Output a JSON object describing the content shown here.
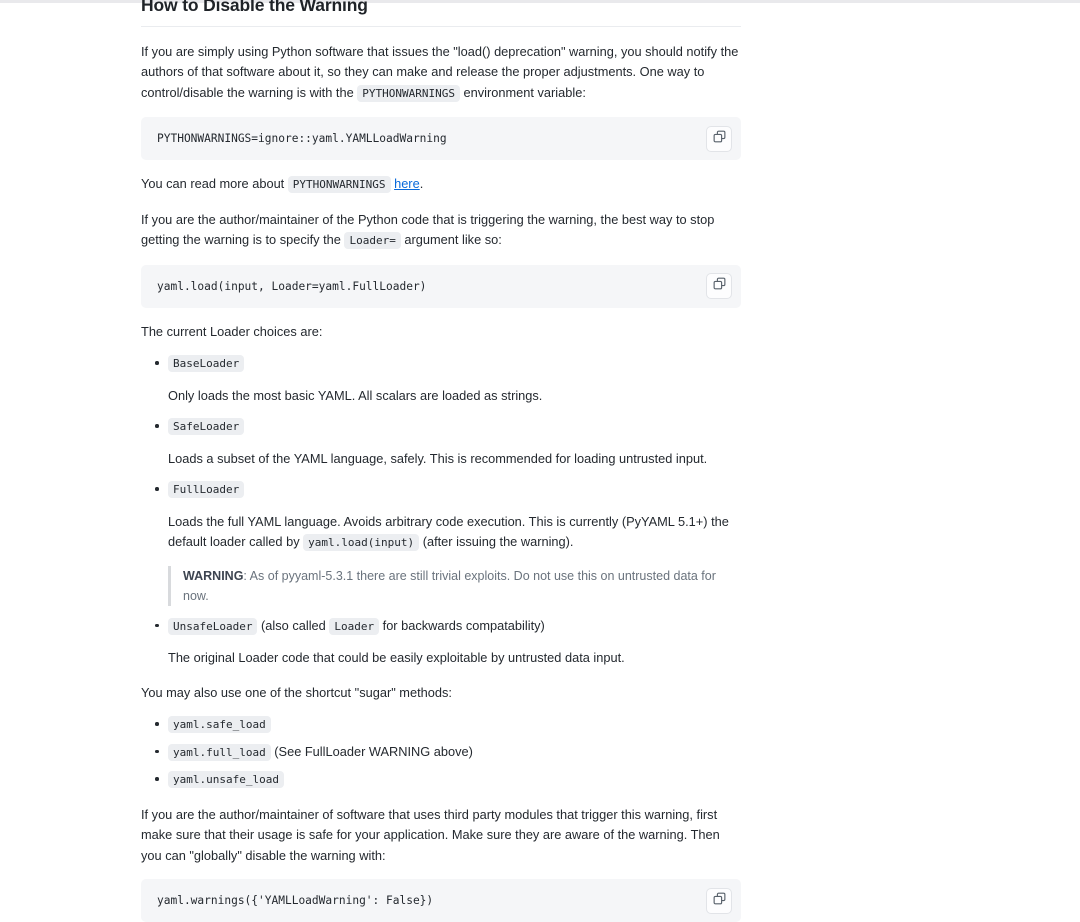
{
  "document": {
    "heading": "How to Disable the Warning",
    "paragraph_1": {
      "part_1": "If you are simply using Python software that issues the \"load() deprecation\" warning, you should notify the authors of that software about it, so they can make and release the proper adjustments. One way to control/disable the warning is with the ",
      "code_1": "PYTHONWARNINGS",
      "part_2": " environment variable:"
    },
    "codeblock_1": {
      "code": "PYTHONWARNINGS=ignore::yaml.YAMLLoadWarning",
      "copy_label": "copy-icon"
    },
    "paragraph_2": {
      "part_1": "You can read more about ",
      "code_1": "PYTHONWARNINGS",
      "part_2": " ",
      "link_text": "here",
      "part_3": "."
    },
    "paragraph_3": {
      "part_1": "If you are the author/maintainer of the Python code that is triggering the warning, the best way to stop getting the warning is to specify the ",
      "code_1": "Loader=",
      "part_2": " argument like so:"
    },
    "codeblock_2": {
      "code": "yaml.load(input, Loader=yaml.FullLoader)",
      "copy_label": "copy-icon"
    },
    "paragraph_4": "The current Loader choices are:",
    "loader_list": [
      {
        "name": "BaseLoader",
        "description": "Only loads the most basic YAML. All scalars are loaded as strings."
      },
      {
        "name": "SafeLoader",
        "description": "Loads a subset of the YAML language, safely. This is recommended for loading untrusted input."
      },
      {
        "name": "FullLoader",
        "description_part_1": "Loads the full YAML language. Avoids arbitrary code execution. This is currently (PyYAML 5.1+) the default loader called by ",
        "description_code": "yaml.load(input)",
        "description_part_2": " (after issuing the warning).",
        "warning_label": "WARNING",
        "warning_text": ": As of pyyaml-5.3.1 there are still trivial exploits. Do not use this on untrusted data for now."
      },
      {
        "name": "UnsafeLoader",
        "suffix_part_1": " (also called ",
        "suffix_code": "Loader",
        "suffix_part_2": " for backwards compatability)",
        "description": "The original Loader code that could be easily exploitable by untrusted data input."
      }
    ],
    "paragraph_5": "You may also use one of the shortcut \"sugar\" methods:",
    "sugar_methods": [
      {
        "code": "yaml.safe_load",
        "note": ""
      },
      {
        "code": "yaml.full_load",
        "note": " (See FullLoader WARNING above)"
      },
      {
        "code": "yaml.unsafe_load",
        "note": ""
      }
    ],
    "paragraph_6": "If you are the author/maintainer of software that uses third party modules that trigger this warning, first make sure that their usage is safe for your application. Make sure they are aware of the warning. Then you can \"globally\" disable the warning with:",
    "codeblock_3": {
      "code": "yaml.warnings({'YAMLLoadWarning': False})",
      "copy_label": "copy-icon"
    }
  },
  "colors": {
    "link": "#0969da",
    "code_bg": "#f5f6f8",
    "inline_code_bg": "#eceef1",
    "text": "#24292f",
    "muted": "#6a737d"
  }
}
